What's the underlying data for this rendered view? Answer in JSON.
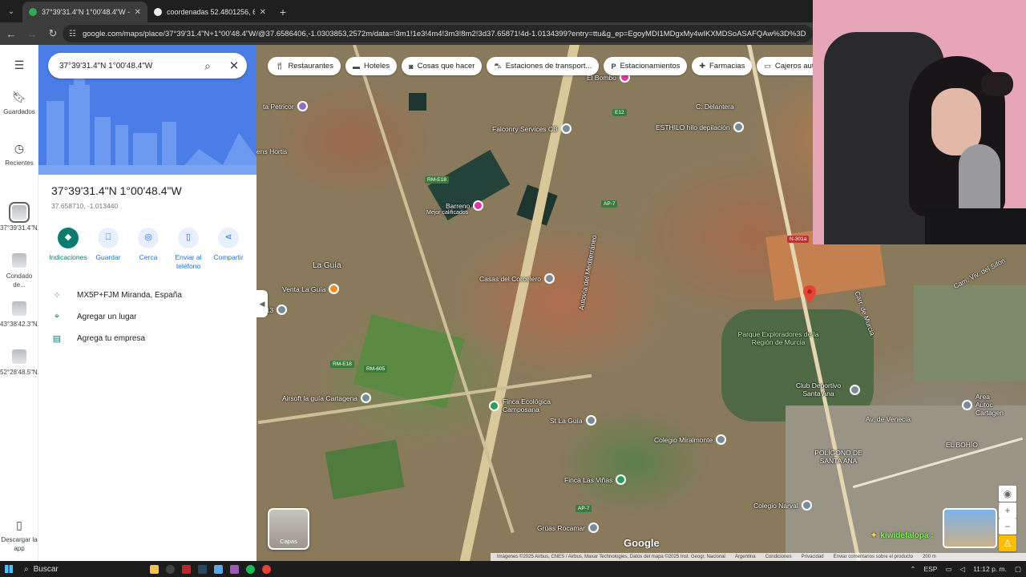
{
  "browser": {
    "tabs": [
      {
        "title": "37°39'31.4\"N 1°00'48.4\"W - Go",
        "active": true,
        "favicon_color": "#34a853"
      },
      {
        "title": "coordenadas 52.4801256, 62.18",
        "active": false,
        "favicon_color": "#e8eaed"
      }
    ],
    "url": "google.com/maps/place/37°39'31.4\"N+1°00'48.4\"W/@37.6586406,-1.0303853,2572m/data=!3m1!1e3!4m4!3m3!8m2!3d37.65871!4d-1.0134399?entry=ttu&g_ep=EgoyMDI1MDgxMy4wIKXMDSoASAFQAw%3D%3D"
  },
  "rail": {
    "saved": "Guardados",
    "recent": "Recientes",
    "history": [
      {
        "label": "37°39'31.4\"N..."
      },
      {
        "label": "Condado de..."
      },
      {
        "label": "43°38'42.3\"N..."
      },
      {
        "label": "52°28'48.5\"N..."
      }
    ],
    "download": "Descargar la app"
  },
  "search": {
    "query": "37°39'31.4\"N 1°00'48.4\"W"
  },
  "place": {
    "title": "37°39'31.4\"N 1°00'48.4\"W",
    "coords": "37.658710, -1.013440",
    "actions": [
      {
        "label": "Indicaciones",
        "icon": "directions-icon"
      },
      {
        "label": "Guardar",
        "icon": "bookmark-icon"
      },
      {
        "label": "Cerca",
        "icon": "nearby-icon"
      },
      {
        "label": "Enviar al teléfono",
        "icon": "phone-icon"
      },
      {
        "label": "Compartir",
        "icon": "share-icon"
      }
    ],
    "plus_code": "MX5P+FJM Miranda, España",
    "add_place": "Agregar un lugar",
    "add_business": "Agrega tu empresa"
  },
  "chips": [
    {
      "label": "Restaurantes",
      "icon": "fork-knife-icon"
    },
    {
      "label": "Hoteles",
      "icon": "bed-icon"
    },
    {
      "label": "Cosas que hacer",
      "icon": "camera-icon"
    },
    {
      "label": "Estaciones de transport...",
      "icon": "transit-icon"
    },
    {
      "label": "Estacionamientos",
      "icon": "parking-icon"
    },
    {
      "label": "Farmacias",
      "icon": "pharmacy-icon"
    },
    {
      "label": "Cajeros autom",
      "icon": "atm-icon"
    }
  ],
  "map": {
    "labels": [
      {
        "text": "El Bombo"
      },
      {
        "text": "C. Delantera"
      },
      {
        "text": "ta Petricor"
      },
      {
        "text": "Falconry Services CB"
      },
      {
        "text": "ESTHILO hilo depilación"
      },
      {
        "text": "ens Hortis"
      },
      {
        "text": "Barreno"
      },
      {
        "text": "Mejor calificados"
      },
      {
        "text": "La Guía"
      },
      {
        "text": "Venta La Guía"
      },
      {
        "text": "ge 13"
      },
      {
        "text": "Casas del Corcelero"
      },
      {
        "text": "Autovía del Mediterráneo"
      },
      {
        "text": "Parque Exploradores de la Región de Murcia"
      },
      {
        "text": "Club Deportivo Santa Ana"
      },
      {
        "text": "Airsoft la guía Cartagena"
      },
      {
        "text": "Finca Ecológica Camposana"
      },
      {
        "text": "St La Guía"
      },
      {
        "text": "Colegio Miralmonte"
      },
      {
        "text": "POLÍGONO DE SANTA ANA"
      },
      {
        "text": "Av. de Venecia"
      },
      {
        "text": "EL BOHÍO"
      },
      {
        "text": "Area Autoc Cartagen"
      },
      {
        "text": "Finca Las Viñas"
      },
      {
        "text": "Colegio Narval"
      },
      {
        "text": "Grúas Rocamar"
      },
      {
        "text": "Cam. Viv. del Sifón"
      },
      {
        "text": "Carr. de Murcia"
      }
    ],
    "shields": [
      "RM-E18",
      "AP-7",
      "E12",
      "N-301a",
      "RM-E18",
      "RM-605",
      "AP-7"
    ],
    "layers_label": "Capas",
    "google": "Google",
    "attribution": [
      "Imágenes ©2025 Airbus, CNES / Airbus, Maxar Technologies, Datos del mapa ©2025 Inst. Geogr. Nacional",
      "Argentina",
      "Condiciones",
      "Privacidad",
      "Enviar comentarios sobre el producto",
      "200 m"
    ]
  },
  "stream": {
    "chat_user": "kiwidefalopa :"
  },
  "taskbar": {
    "search": "Buscar",
    "lang": "ESP",
    "time": "11:12 p. m."
  }
}
